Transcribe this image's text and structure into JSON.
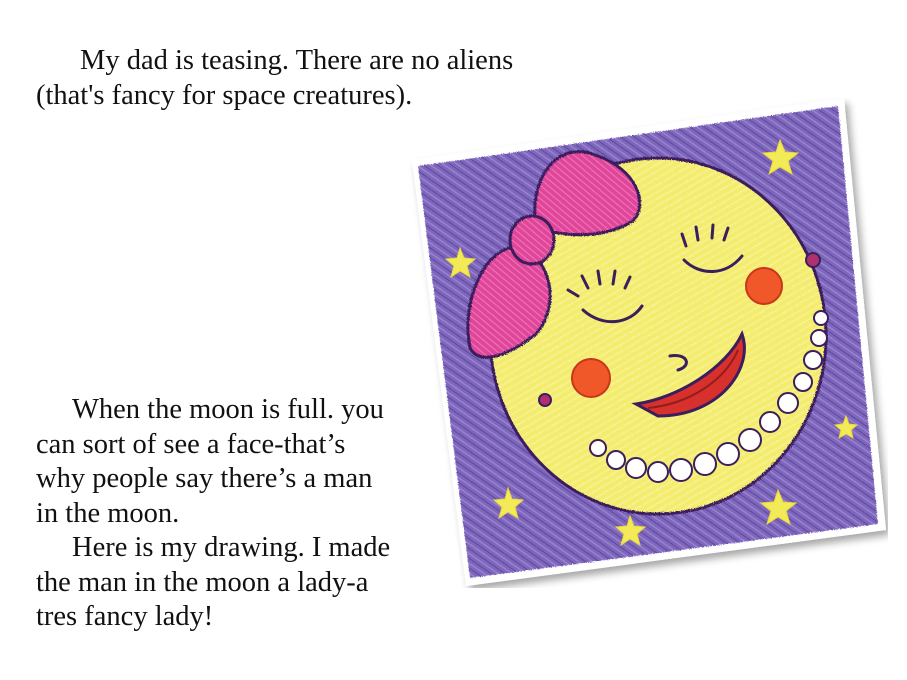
{
  "top_text": {
    "line1": "My dad is teasing. There are no aliens",
    "line2": "(that's fancy for space creatures)."
  },
  "bottom_text": {
    "line1": "When the moon is full. you",
    "line2": "can sort of see a face-that’s",
    "line3": "why people say there’s a man",
    "line4": "in the moon.",
    "line5": "Here is my drawing. I made",
    "line6": "the man in the moon a lady-a",
    "line7": "tres fancy lady!"
  },
  "drawing": {
    "subject": "crayon drawing of a smiling moon lady with a pink bow and pearl necklace on a purple starry sky",
    "colors": {
      "sky": "#7b63b8",
      "sky_light": "#a391d1",
      "moon": "#f4ee6a",
      "bow": "#e0459a",
      "cheeks": "#f0582a",
      "lips": "#d8302c",
      "stars": "#f2ea56",
      "outline": "#3a1f5c"
    }
  }
}
